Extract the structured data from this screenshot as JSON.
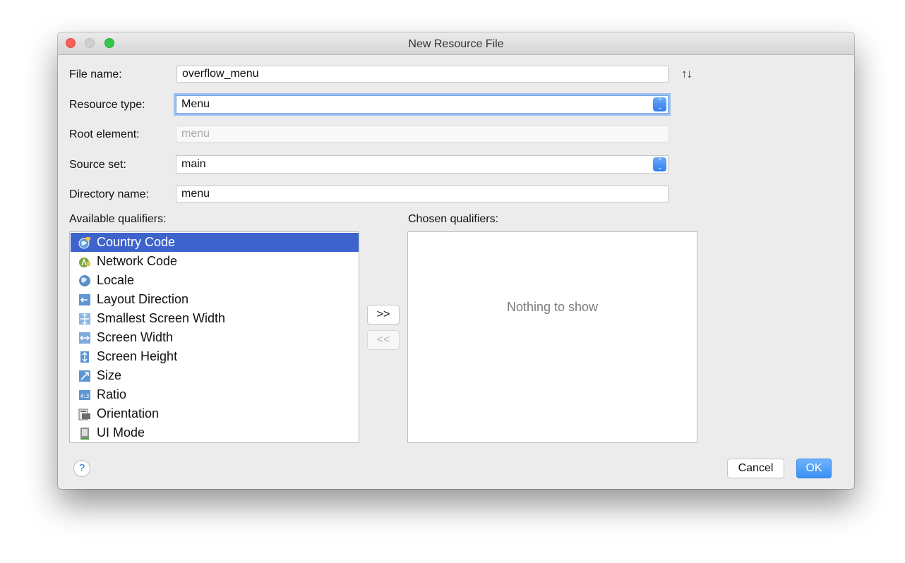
{
  "window": {
    "title": "New Resource File"
  },
  "form": {
    "file_name_label": "File name:",
    "file_name_value": "overflow_menu",
    "resource_type_label": "Resource type:",
    "resource_type_value": "Menu",
    "root_element_label": "Root element:",
    "root_element_value": "menu",
    "source_set_label": "Source set:",
    "source_set_value": "main",
    "directory_name_label": "Directory name:",
    "directory_name_value": "menu"
  },
  "qualifiers": {
    "available_label": "Available qualifiers:",
    "chosen_label": "Chosen qualifiers:",
    "available": [
      {
        "label": "Country Code",
        "icon": "globe-flag-icon",
        "selected": true
      },
      {
        "label": "Network Code",
        "icon": "network-icon"
      },
      {
        "label": "Locale",
        "icon": "globe-icon"
      },
      {
        "label": "Layout Direction",
        "icon": "layout-direction-icon"
      },
      {
        "label": "Smallest Screen Width",
        "icon": "smallest-width-icon"
      },
      {
        "label": "Screen Width",
        "icon": "screen-width-icon"
      },
      {
        "label": "Screen Height",
        "icon": "screen-height-icon"
      },
      {
        "label": "Size",
        "icon": "size-icon"
      },
      {
        "label": "Ratio",
        "icon": "ratio-icon"
      },
      {
        "label": "Orientation",
        "icon": "orientation-icon"
      },
      {
        "label": "UI Mode",
        "icon": "ui-mode-icon"
      }
    ],
    "empty_text": "Nothing to show",
    "add_label": ">>",
    "remove_label": "<<"
  },
  "buttons": {
    "cancel": "Cancel",
    "ok": "OK",
    "help": "?"
  },
  "colors": {
    "accent": "#3e63cc",
    "primary_button": "#3b8ff3",
    "focus_ring": "#9cc1ef"
  }
}
